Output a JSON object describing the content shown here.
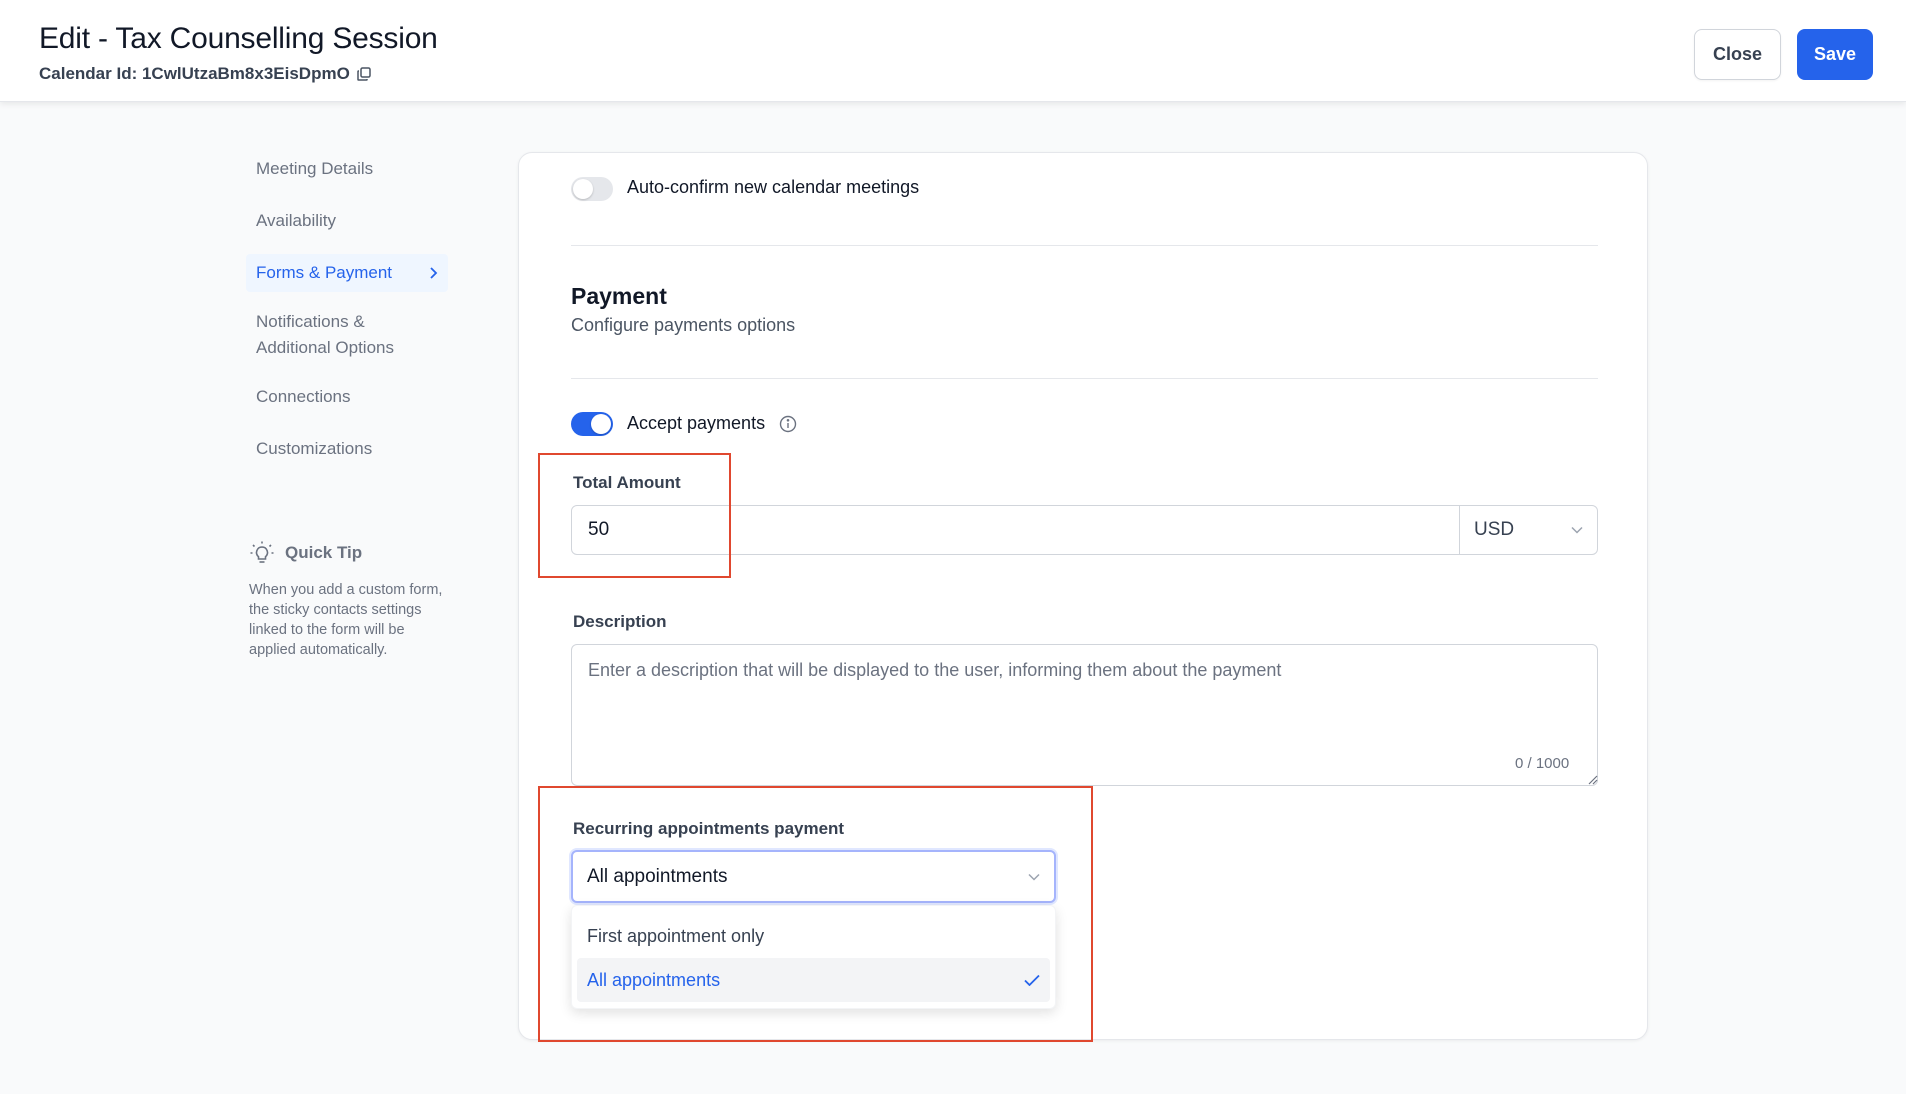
{
  "header": {
    "title": "Edit - Tax Counselling Session",
    "calendar_id_label": "Calendar Id: 1CwlUtzaBm8x3EisDpmO",
    "close_label": "Close",
    "save_label": "Save"
  },
  "sidebar": {
    "items": [
      {
        "label": "Meeting Details"
      },
      {
        "label": "Availability"
      },
      {
        "label": "Forms & Payment"
      },
      {
        "label": "Notifications & Additional Options"
      },
      {
        "label": "Connections"
      },
      {
        "label": "Customizations"
      }
    ],
    "quick_tip": {
      "title": "Quick Tip",
      "text": "When you add a custom form, the sticky contacts settings linked to the form will be applied automatically."
    }
  },
  "main": {
    "auto_confirm": {
      "label": "Auto-confirm new calendar meetings",
      "enabled": false
    },
    "payment": {
      "title": "Payment",
      "subtitle": "Configure payments options",
      "accept_payments": {
        "label": "Accept payments",
        "enabled": true
      },
      "total_amount": {
        "label": "Total Amount",
        "value": "50",
        "currency": "USD"
      },
      "description": {
        "label": "Description",
        "placeholder": "Enter a description that will be displayed to the user, informing them about the payment",
        "counter": "0 / 1000"
      },
      "recurring": {
        "label": "Recurring appointments payment",
        "selected": "All appointments",
        "options": [
          {
            "label": "First appointment only"
          },
          {
            "label": "All appointments"
          }
        ]
      }
    }
  },
  "colors": {
    "accent": "#2563eb",
    "highlight": "#e0482f"
  }
}
